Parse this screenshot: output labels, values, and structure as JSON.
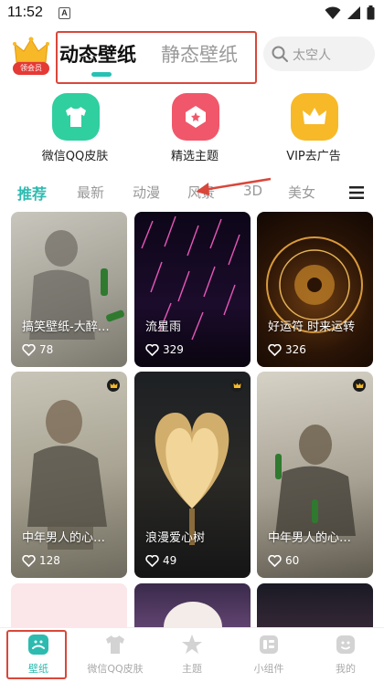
{
  "status_bar": {
    "time": "11:52",
    "notification_letter": "A"
  },
  "header": {
    "vip_badge_label": "领会员",
    "type_tabs": [
      {
        "label": "动态壁纸",
        "active": true
      },
      {
        "label": "静态壁纸",
        "active": false
      }
    ],
    "search": {
      "text": "太空人"
    }
  },
  "shortcuts": [
    {
      "label": "微信QQ皮肤",
      "icon": "tshirt-icon",
      "color": "#2fcf9f"
    },
    {
      "label": "精选主题",
      "icon": "theme-icon",
      "color": "#f0576a"
    },
    {
      "label": "VIP去广告",
      "icon": "crown-icon",
      "color": "#f7b928"
    }
  ],
  "categories": [
    {
      "label": "推荐",
      "active": true
    },
    {
      "label": "最新",
      "active": false
    },
    {
      "label": "动漫",
      "active": false
    },
    {
      "label": "风景",
      "active": false
    },
    {
      "label": "3D",
      "active": false
    },
    {
      "label": "美女",
      "active": false
    }
  ],
  "cards": [
    {
      "title": "搞笑壁纸-大醉…",
      "likes": "78",
      "vip": false
    },
    {
      "title": "流星雨",
      "likes": "329",
      "vip": false
    },
    {
      "title": "好运符  时来运转",
      "likes": "326",
      "vip": false
    },
    {
      "title": "中年男人的心…",
      "likes": "128",
      "vip": true
    },
    {
      "title": "浪漫爱心树",
      "likes": "49",
      "vip": true
    },
    {
      "title": "中年男人的心…",
      "likes": "60",
      "vip": true
    }
  ],
  "bottom_nav": [
    {
      "label": "壁纸",
      "active": true
    },
    {
      "label": "微信QQ皮肤",
      "active": false
    },
    {
      "label": "主题",
      "active": false
    },
    {
      "label": "小组件",
      "active": false
    },
    {
      "label": "我的",
      "active": false
    }
  ],
  "colors": {
    "accent": "#2dbbb0",
    "annotation": "#d9473b"
  }
}
